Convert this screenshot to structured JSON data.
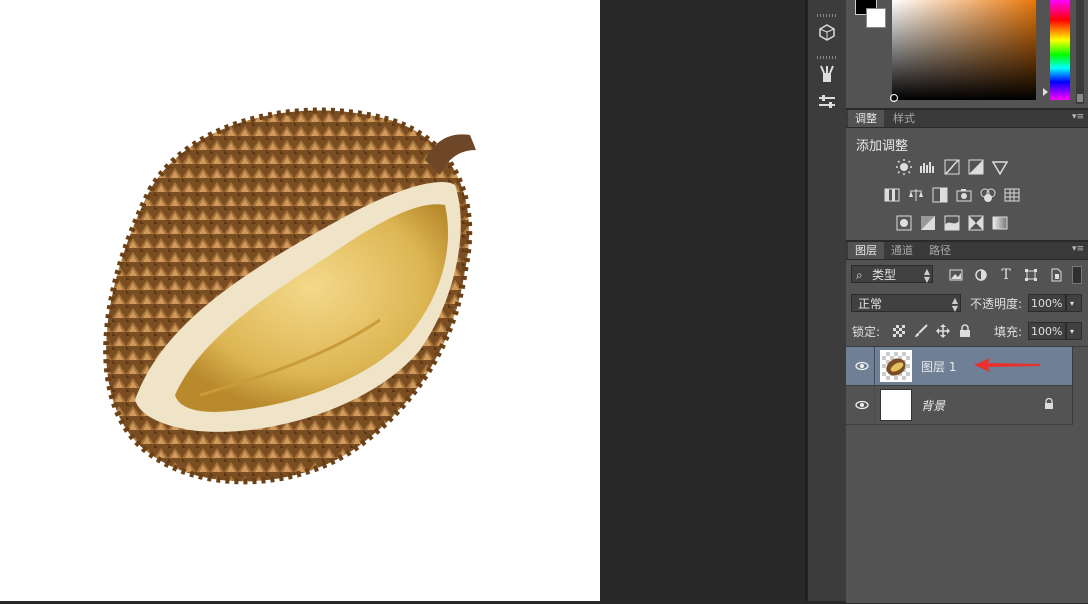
{
  "adjustments": {
    "tabs": [
      "调整",
      "样式"
    ],
    "title": "添加调整"
  },
  "layers": {
    "tabs": [
      "图层",
      "通道",
      "路径"
    ],
    "filter_label": "类型",
    "blend_mode": "正常",
    "opacity_label": "不透明度:",
    "opacity_value": "100%",
    "lock_label": "锁定:",
    "fill_label": "填充:",
    "fill_value": "100%",
    "items": [
      {
        "name": "图层 1",
        "selected": true
      },
      {
        "name": "背景",
        "selected": false
      }
    ]
  },
  "colors": {
    "selected_layer_bg": "#6f8096",
    "annotation_arrow": "#e8312f",
    "foreground": "#000000",
    "background": "#ffffff"
  }
}
